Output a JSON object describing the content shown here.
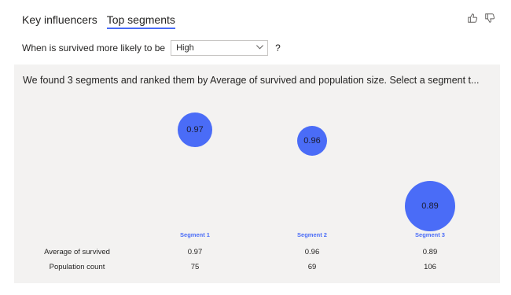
{
  "tabs": [
    {
      "label": "Key influencers",
      "active": false
    },
    {
      "label": "Top segments",
      "active": true
    }
  ],
  "feedback": {
    "like_icon": "thumbs-up-icon",
    "dislike_icon": "thumbs-down-icon"
  },
  "question": {
    "prefix": "When is survived more likely to be",
    "selected": "High",
    "suffix": "?"
  },
  "summary": "We found 3 segments and ranked them by Average of survived and population size. Select a segment t...",
  "segments": [
    {
      "label": "Segment 1",
      "avg_survived": "0.97",
      "population": "75"
    },
    {
      "label": "Segment 2",
      "avg_survived": "0.96",
      "population": "69"
    },
    {
      "label": "Segment 3",
      "avg_survived": "0.89",
      "population": "106"
    }
  ],
  "table": {
    "row_labels": [
      "Average of survived",
      "Population count"
    ]
  },
  "colors": {
    "accent": "#4a6cf7",
    "panel": "#f3f2f1"
  }
}
